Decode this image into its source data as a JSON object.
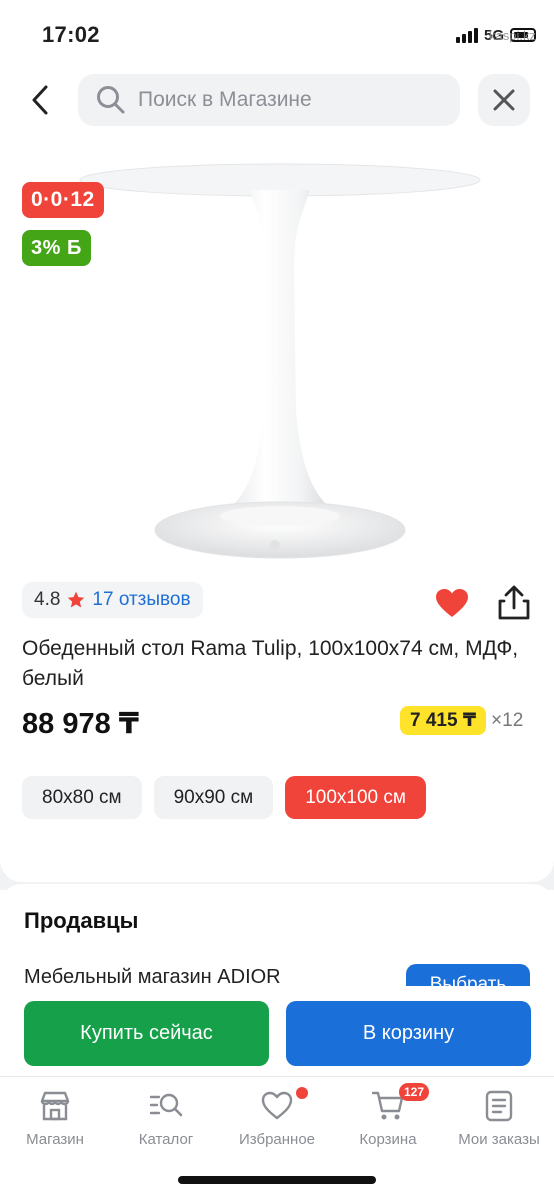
{
  "status_bar": {
    "time": "17:02",
    "network": "5G",
    "watermark": "kaspi.kz"
  },
  "search": {
    "placeholder": "Поиск в Магазине"
  },
  "badges": {
    "installment": "0·0·12",
    "bonus": "3% Б"
  },
  "rating": {
    "value": "4.8",
    "reviews": "17 отзывов"
  },
  "product": {
    "title": "Обеденный стол Rama Tulip, 100x100x74 см, МДФ, белый",
    "price": "88 978 ₸",
    "monthly_payment": "7 415 ₸",
    "monthly_multiplier": "×12",
    "favorite": true
  },
  "sizes": [
    {
      "label": "80x80 см",
      "selected": false
    },
    {
      "label": "90x90 см",
      "selected": false
    },
    {
      "label": "100x100 см",
      "selected": true
    }
  ],
  "sellers": {
    "title": "Продавцы",
    "first_seller": "Мебельный магазин ADIOR",
    "choose_label": "Выбрать"
  },
  "actions": {
    "buy_now": "Купить сейчас",
    "add_to_cart": "В корзину"
  },
  "tabs": [
    {
      "label": "Магазин",
      "icon": "shop-icon"
    },
    {
      "label": "Каталог",
      "icon": "catalog-search-icon"
    },
    {
      "label": "Избранное",
      "icon": "heart-icon"
    },
    {
      "label": "Корзина",
      "icon": "cart-icon",
      "badge": "127"
    },
    {
      "label": "Мои заказы",
      "icon": "orders-icon"
    }
  ],
  "colors": {
    "accent_red": "#f0433a",
    "bonus_green": "#44a616",
    "buy_green": "#16a04a",
    "primary_blue": "#1a6fd8",
    "monthly_yellow": "#ffe22a"
  }
}
